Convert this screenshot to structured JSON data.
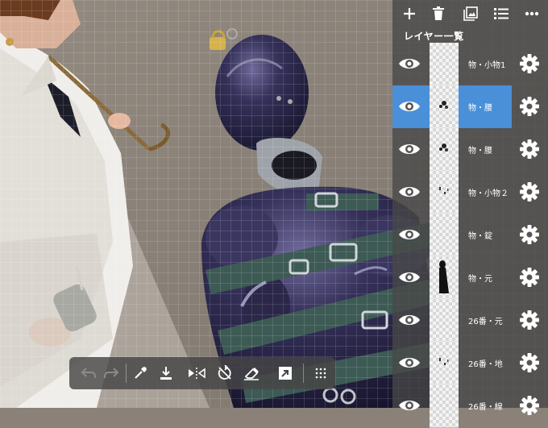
{
  "panel": {
    "title": "レイヤー一覧",
    "toolbar": [
      {
        "icon": "add-icon"
      },
      {
        "icon": "trash-icon"
      },
      {
        "icon": "image-icon"
      },
      {
        "icon": "list-icon"
      },
      {
        "icon": "more-icon"
      }
    ],
    "layers": [
      {
        "name": "物・小物1",
        "selected": false,
        "thumb": "empty"
      },
      {
        "name": "物・腰",
        "selected": true,
        "thumb": "dots"
      },
      {
        "name": "物・腰",
        "selected": false,
        "thumb": "dots"
      },
      {
        "name": "物・小物２",
        "selected": false,
        "thumb": "specks"
      },
      {
        "name": "物・錠",
        "selected": false,
        "thumb": "empty"
      },
      {
        "name": "物・元",
        "selected": false,
        "thumb": "figure"
      },
      {
        "name": "26番・元",
        "selected": false,
        "thumb": "empty"
      },
      {
        "name": "26番・地",
        "selected": false,
        "thumb": "specks"
      },
      {
        "name": "26番・線",
        "selected": false,
        "thumb": "empty"
      }
    ]
  },
  "bottom_toolbar": {
    "tools": [
      {
        "icon": "undo-icon",
        "enabled": false
      },
      {
        "icon": "redo-icon",
        "enabled": false
      },
      {
        "icon": "eyedropper-icon",
        "enabled": true
      },
      {
        "icon": "import-icon",
        "enabled": true
      },
      {
        "icon": "flip-horizontal-icon",
        "enabled": true
      },
      {
        "icon": "rotate-reset-icon",
        "enabled": true
      },
      {
        "icon": "eraser-icon",
        "enabled": true
      },
      {
        "icon": "transform-icon",
        "enabled": true
      },
      {
        "icon": "grid-menu-icon",
        "enabled": true
      }
    ]
  },
  "colors": {
    "selected_layer": "#4a90d9",
    "panel_bg": "#484848",
    "canvas_wall": "#8a8178",
    "suit_purple": "#2e2b4a",
    "strap_green": "#3d5a55"
  }
}
